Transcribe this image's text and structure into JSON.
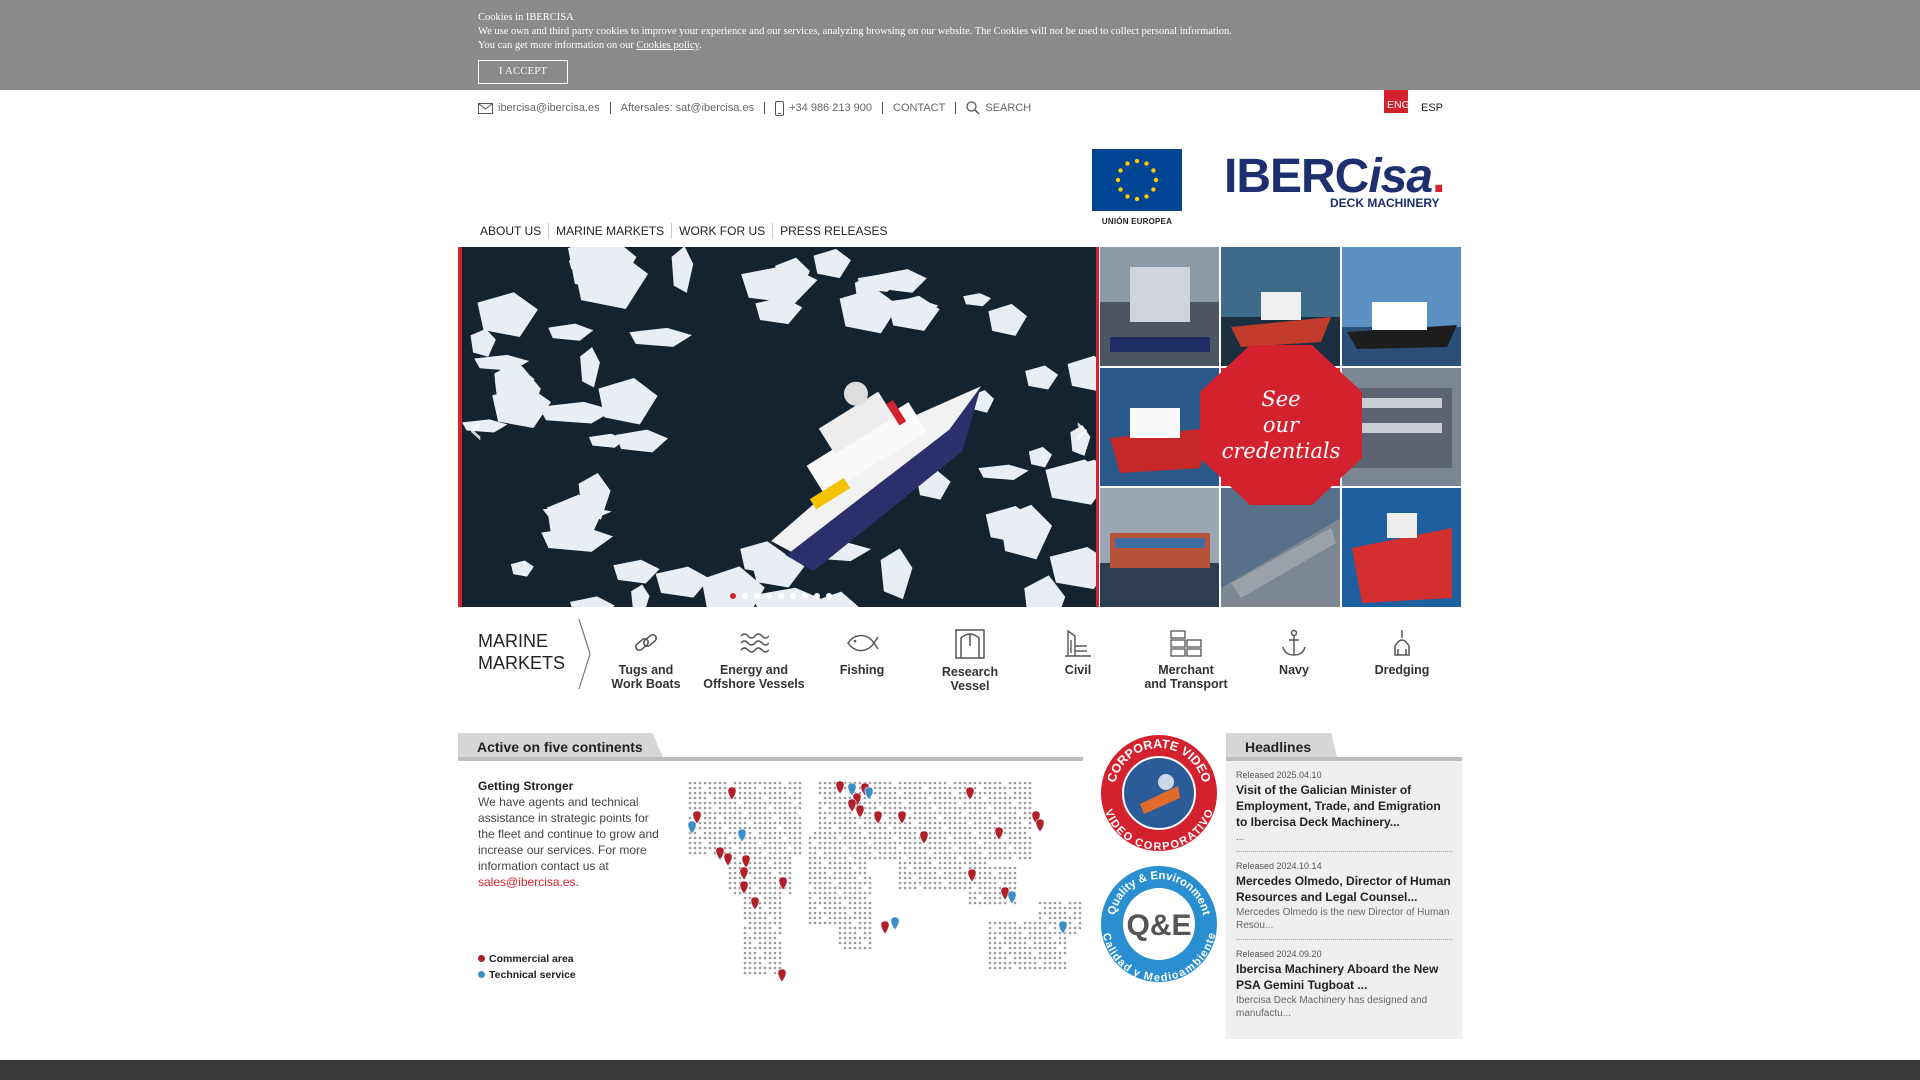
{
  "cookie": {
    "title": "Cookies in IBERCISA",
    "text": "We use own and third party cookies to improve your experience and our services, analyzing browsing on our website. The Cookies will not be used to collect personal information.",
    "more_prefix": "You can get more information on our ",
    "policy_link": "Cookies policy",
    "more_suffix": ".",
    "accept": "I ACCEPT"
  },
  "toplinks": {
    "email": "ibercisa@ibercisa.es",
    "aftersales": "Aftersales: sat@ibercisa.es",
    "phone": "+34 986 213 900",
    "contact": "CONTACT",
    "search": "SEARCH"
  },
  "lang": {
    "eng": "ENG",
    "esp": "ESP"
  },
  "eu": {
    "caption": "UNIÓN EUROPEA",
    "flag_color": "#004494"
  },
  "brand": {
    "name_a": "IBERC",
    "name_b": "isa",
    "dot": ".",
    "sub": "DECK MACHINERY",
    "color": "#1d2f6f",
    "accent": "#d4212e"
  },
  "nav": [
    "ABOUT US",
    "MARINE MARKETS",
    "WORK FOR US",
    "PRESS RELEASES"
  ],
  "hero": {
    "prev": "‹",
    "next": "›",
    "slides": 9,
    "active": 0
  },
  "credentials": {
    "line1": "See",
    "line2": "our",
    "line3": "credentials"
  },
  "markets": {
    "title_1": "MARINE",
    "title_2": "MARKETS",
    "items": [
      {
        "l1": "Tugs and",
        "l2": "Work Boats",
        "icon": "chain-icon"
      },
      {
        "l1": "Energy and",
        "l2": "Offshore Vessels",
        "icon": "waves-icon"
      },
      {
        "l1": "Fishing",
        "l2": "",
        "icon": "fish-icon"
      },
      {
        "l1": "Research",
        "l2": "Vessel",
        "icon": "crane-frame-icon"
      },
      {
        "l1": "Civil",
        "l2": "",
        "icon": "building-icon"
      },
      {
        "l1": "Merchant",
        "l2": "and Transport",
        "icon": "containers-icon"
      },
      {
        "l1": "Navy",
        "l2": "",
        "icon": "anchor-icon"
      },
      {
        "l1": "Dredging",
        "l2": "",
        "icon": "dredge-icon"
      }
    ]
  },
  "continents": {
    "tab": "Active on five continents",
    "heading": "Getting Stronger",
    "body": "We have agents and technical assistance in strategic points for the fleet and continue to grow and increase our services. For more information contact us at",
    "email": "sales@ibercisa.es",
    "email_suffix": ".",
    "legend_commercial": "Commercial area",
    "legend_technical": "Technical service",
    "commercial_color": "#b0202a",
    "technical_color": "#3a8fc7"
  },
  "badges": {
    "video_top": "CORPORATE VIDEO",
    "video_bottom": "VIDEO CORPORATIVO",
    "qe_top": "Quality & Environment",
    "qe_bottom": "Calidad y Medioambiente",
    "qe_mark": "Q&E"
  },
  "headlines": {
    "tab": "Headlines",
    "items": [
      {
        "date": "Released 2025.04.10",
        "title": "Visit of the Galician Minister of Employment, Trade, and Emigration to Ibercisa Deck Machinery...",
        "excerpt": "..."
      },
      {
        "date": "Released 2024.10.14",
        "title": "Mercedes Olmedo, Director of Human Resources and Legal Counsel...",
        "excerpt": "Mercedes Olmedo is the new Director of Human Resou..."
      },
      {
        "date": "Released 2024.09.20",
        "title": "Ibercisa Machinery Aboard the New PSA Gemini Tugboat ...",
        "excerpt": "Ibercisa Deck Machinery has designed and manufactu..."
      }
    ]
  }
}
